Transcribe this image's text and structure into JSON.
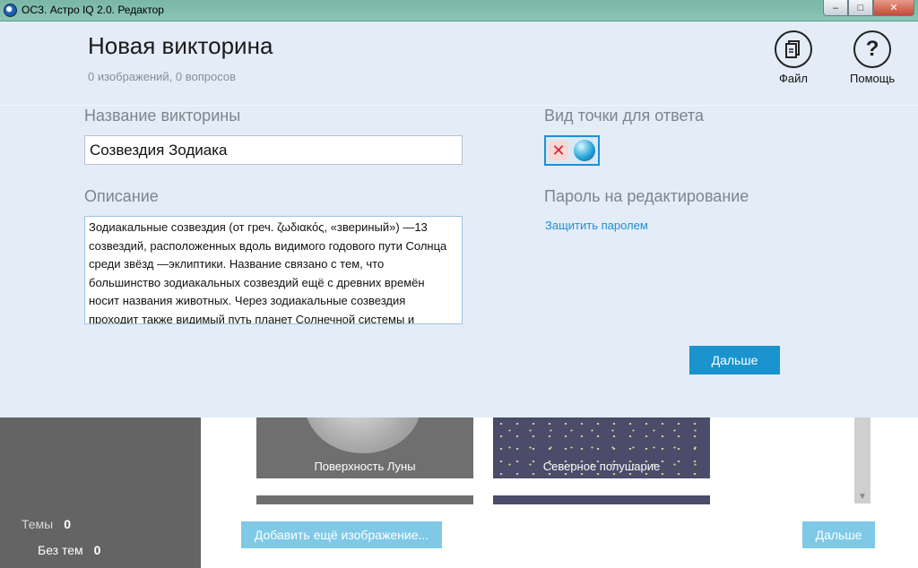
{
  "window": {
    "title": "ОСЗ. Астро IQ 2.0. Редактор",
    "minimize": "–",
    "maximize": "□",
    "close": "✕"
  },
  "header": {
    "title": "Новая викторина",
    "subtitle": "0 изображений, 0 вопросов",
    "file_label": "Файл",
    "help_label": "Помощь",
    "help_glyph": "?"
  },
  "form": {
    "name_label": "Название викторины",
    "name_value": "Созвездия Зодиака",
    "description_label": "Описание",
    "description_value": "Зодиакальные созвездия (от греч. ζωδιακός, «звериный») —13 созвездий, расположенных вдоль видимого годового пути Солнца среди звёзд —эклиптики. Название связано с тем, что большинство зодиакальных созвездий ещё с древних времён носит названия животных. Через зодиакальные созвездия проходит также видимый путь планет Солнечной системы и",
    "point_type_label": "Вид точки для ответа",
    "point_type_x_glyph": "✕",
    "password_label": "Пароль на редактирование",
    "password_link": "Защитить паролем",
    "next_button": "Дальше"
  },
  "icons": {
    "file": "file-icon",
    "help": "help-icon",
    "point_cross": "cross-icon",
    "point_ball": "ball-icon"
  },
  "background": {
    "sidebar": {
      "themes_label": "Темы",
      "themes_count": "0",
      "no_themes_label": "Без тем",
      "no_themes_count": "0"
    },
    "images": [
      {
        "label": "Поверхность Луны"
      },
      {
        "label": "Северное полушарие"
      }
    ],
    "add_image_button": "Добавить ещё изображение...",
    "next_button": "Дальше"
  },
  "colors": {
    "overlay_bg": "#e3ecf7",
    "accent": "#1a93cf",
    "link": "#1e8fd6"
  }
}
